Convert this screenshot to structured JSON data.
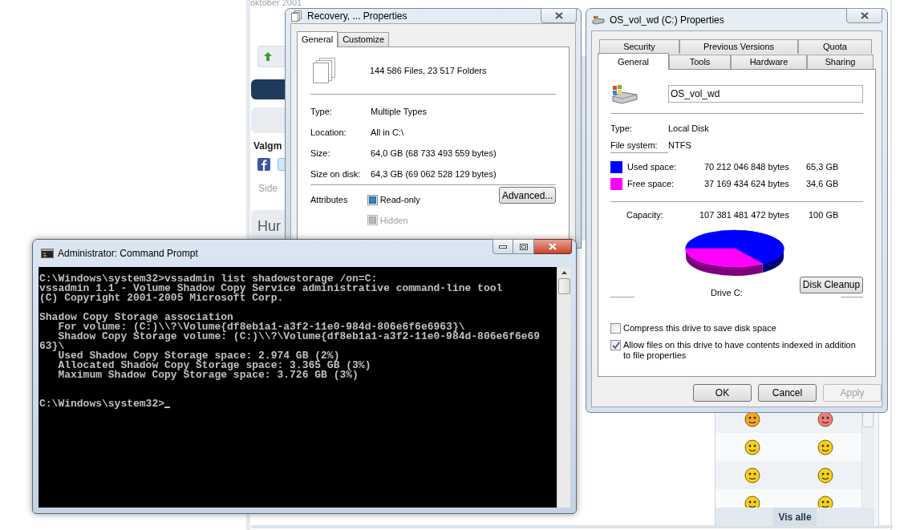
{
  "background_page": {
    "date": "oktober 2001",
    "heading": "Valgm",
    "side_text": "Side",
    "box_heading": "Hur",
    "show_all_button": "Vis alle"
  },
  "recovery_window": {
    "title": "Recovery, ... Properties",
    "tabs": [
      {
        "label": "General",
        "selected": true
      },
      {
        "label": "Customize",
        "selected": false
      }
    ],
    "summary": "144 586 Files, 23 517 Folders",
    "fields": [
      {
        "label": "Type:",
        "value": "Multiple Types"
      },
      {
        "label": "Location:",
        "value": "All in C:\\"
      },
      {
        "label": "Size:",
        "value": "64,0 GB (68 733 493 559 bytes)"
      },
      {
        "label": "Size on disk:",
        "value": "64,3 GB (69 062 528 129 bytes)"
      }
    ],
    "attributes_label": "Attributes",
    "attributes": [
      {
        "label": "Read-only",
        "indeterminate": true,
        "disabled": false
      },
      {
        "label": "Hidden",
        "indeterminate": true,
        "disabled": true
      }
    ],
    "advanced_button": "Advanced..."
  },
  "drive_window": {
    "title": "OS_vol_wd (C:) Properties",
    "tabs_back": [
      {
        "label": "Security",
        "selected": false
      },
      {
        "label": "Previous Versions",
        "selected": false
      },
      {
        "label": "Quota",
        "selected": false
      }
    ],
    "tabs_front": [
      {
        "label": "General",
        "selected": true
      },
      {
        "label": "Tools",
        "selected": false
      },
      {
        "label": "Hardware",
        "selected": false
      },
      {
        "label": "Sharing",
        "selected": false
      }
    ],
    "name_field": {
      "value": "OS_vol_wd"
    },
    "info": [
      {
        "label": "Type:",
        "value": "Local Disk"
      },
      {
        "label": "File system:",
        "value": "NTFS"
      }
    ],
    "space": [
      {
        "label": "Used space:",
        "bytes": "70 212 046 848 bytes",
        "size": "65,3 GB",
        "color": "#0000ff"
      },
      {
        "label": "Free space:",
        "bytes": "37 169 434 624 bytes",
        "size": "34,6 GB",
        "color": "#ff00ff"
      }
    ],
    "capacity": {
      "label": "Capacity:",
      "bytes": "107 381 481 472 bytes",
      "size": "100 GB"
    },
    "drive_label": "Drive C:",
    "cleanup_button": "Disk Cleanup",
    "options": [
      {
        "label": "Compress this drive to save disk space",
        "checked": false
      },
      {
        "label": "Allow files on this drive to have contents indexed in addition to file properties",
        "checked": true
      }
    ],
    "buttons": [
      {
        "label": "OK",
        "disabled": false
      },
      {
        "label": "Cancel",
        "disabled": false
      },
      {
        "label": "Apply",
        "disabled": true
      }
    ]
  },
  "console_window": {
    "title": "Administrator: Command Prompt",
    "blocks": [
      {
        "lines": [
          "C:\\Windows\\system32>vssadmin list shadowstorage /on=C:",
          "vssadmin 1.1 - Volume Shadow Copy Service administrative command-line tool",
          "(C) Copyright 2001-2005 Microsoft Corp."
        ]
      },
      {
        "lines": [
          "Shadow Copy Storage association",
          "   For volume: (C:)\\\\?\\Volume{df8eb1a1-a3f2-11e0-984d-806e6f6e6963}\\",
          "   Shadow Copy Storage volume: (C:)\\\\?\\Volume{df8eb1a1-a3f2-11e0-984d-806e6f6e69",
          "63}\\",
          "   Used Shadow Copy Storage space: 2.974 GB (2%)",
          "   Allocated Shadow Copy Storage space: 3.365 GB (3%)",
          "   Maximum Shadow Copy Storage space: 3.726 GB (3%)"
        ]
      }
    ],
    "prompt": "C:\\Windows\\system32>"
  }
}
